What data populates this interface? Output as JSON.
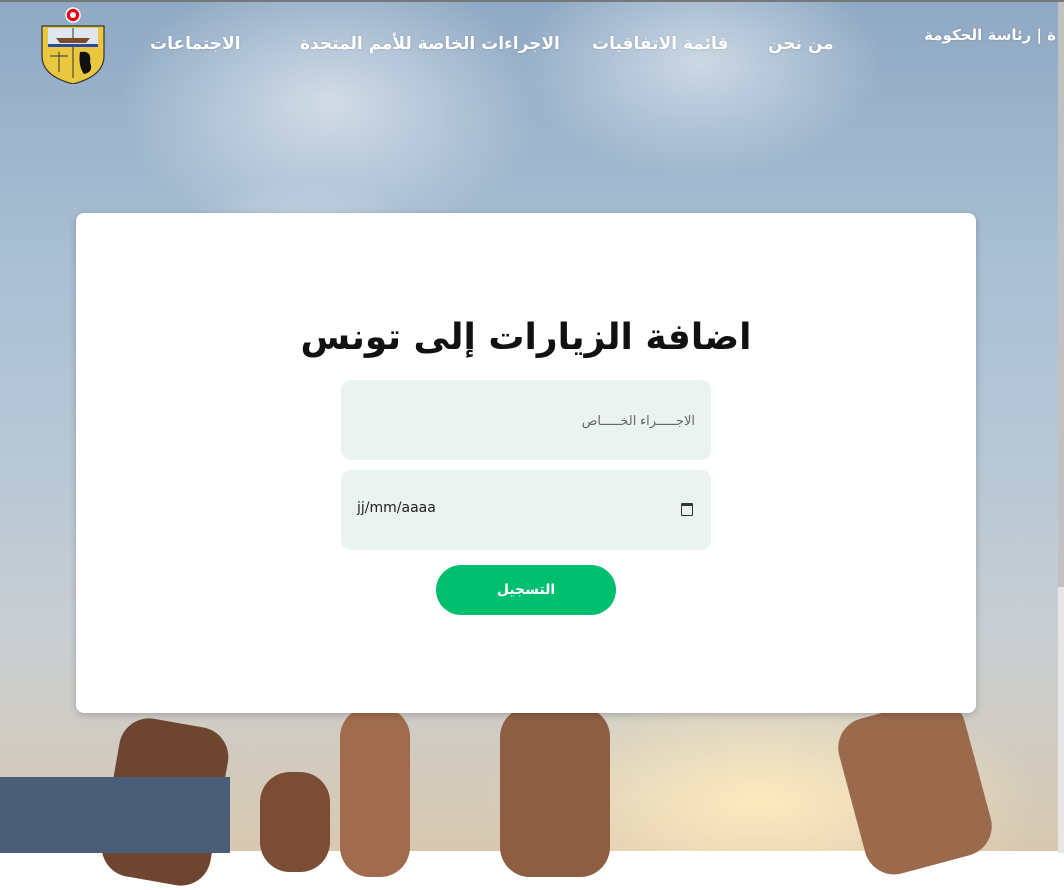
{
  "nav": {
    "items": [
      {
        "label": "ة | رئاسة الحكومة"
      },
      {
        "label": "من نحن"
      },
      {
        "label": "قائمة الاتفاقيات"
      },
      {
        "label": "الاجراءات الخاصة للأمم المتحدة"
      },
      {
        "label": "الاجتماعات"
      }
    ]
  },
  "form": {
    "title": "اضافة الزيارات إلى تونس",
    "procedure_placeholder": "الاجـــــراء الخـــــاص",
    "date_placeholder": "jj/mm/aaaa",
    "submit_label": "التسجيل"
  },
  "colors": {
    "accent": "#00bf6f",
    "field_bg": "#ebf3f1"
  }
}
